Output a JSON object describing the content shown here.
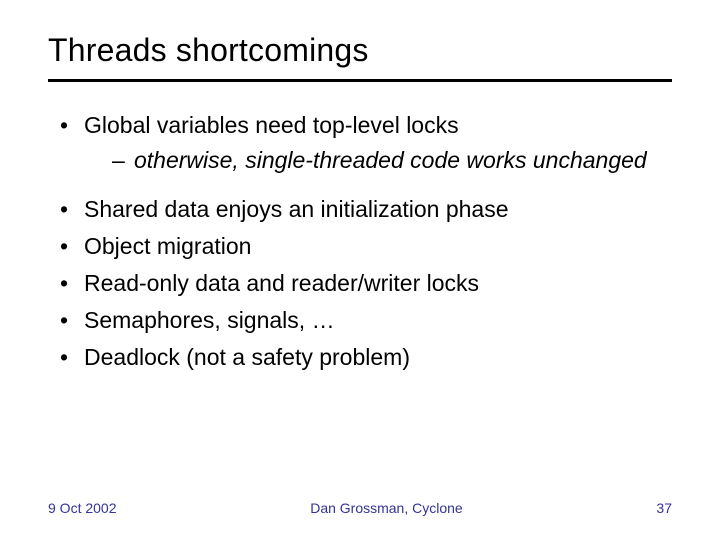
{
  "title": "Threads shortcomings",
  "bullets": {
    "b0": "Global variables need top-level locks",
    "b0_sub0": "otherwise, single-threaded code works unchanged",
    "b1": "Shared data enjoys an initialization phase",
    "b2": "Object migration",
    "b3": "Read-only data and reader/writer locks",
    "b4": "Semaphores, signals, …",
    "b5": "Deadlock (not a safety problem)"
  },
  "footer": {
    "date": "9 Oct 2002",
    "author": "Dan Grossman, Cyclone",
    "page": "37"
  }
}
